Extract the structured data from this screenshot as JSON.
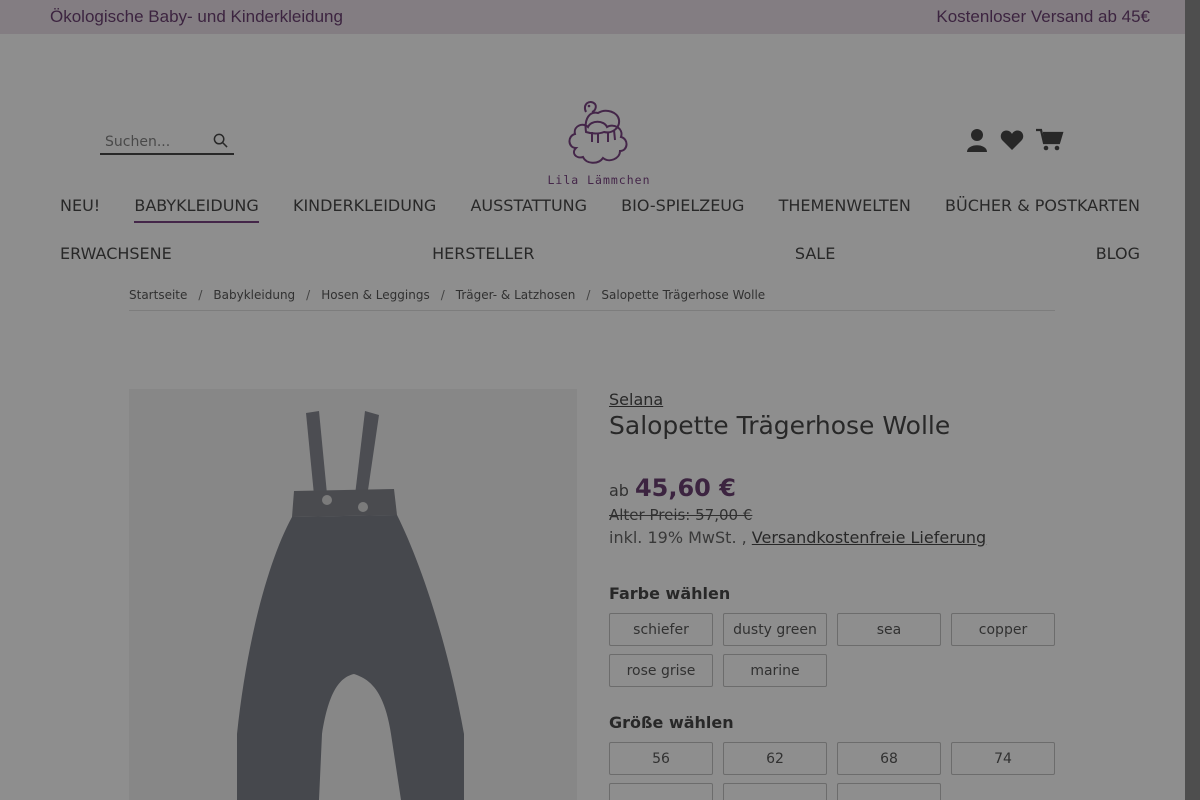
{
  "topbar": {
    "left_text": "Ökologische Baby- und Kinderkleidung",
    "right_text": "Kostenloser Versand ab 45€"
  },
  "header": {
    "search_placeholder": "Suchen...",
    "logo_text": "Lila Lämmchen",
    "icons": [
      "user-icon",
      "heart-icon",
      "cart-icon"
    ]
  },
  "nav": {
    "row1": [
      "NEU!",
      "BABYKLEIDUNG",
      "KINDERKLEIDUNG",
      "AUSSTATTUNG",
      "BIO-SPIELZEUG",
      "THEMENWELTEN",
      "BÜCHER & POSTKARTEN"
    ],
    "row2": [
      "ERWACHSENE",
      "HERSTELLER",
      "SALE",
      "BLOG"
    ],
    "active": "BABYKLEIDUNG"
  },
  "breadcrumb": [
    "Startseite",
    "Babykleidung",
    "Hosen & Leggings",
    "Träger- & Latzhosen",
    "Salopette Trägerhose Wolle"
  ],
  "product": {
    "brand": "Selana",
    "title": "Salopette Trägerhose Wolle",
    "price_prefix": "ab",
    "price": "45,60 €",
    "old_price": "Alter Preis: 57,00 €",
    "tax_text": "inkl. 19% MwSt. ,",
    "shipping_link": "Versandkostenfreie Lieferung",
    "color_label": "Farbe wählen",
    "colors": [
      "schiefer",
      "dusty green",
      "sea",
      "copper",
      "rose grise",
      "marine"
    ],
    "size_label": "Größe wählen",
    "sizes": [
      "56",
      "62",
      "68",
      "74"
    ]
  },
  "colors": {
    "accent": "#5b2a62",
    "topbar_bg": "#e8dce6",
    "overlay": "rgba(30,30,30,0.5)"
  }
}
